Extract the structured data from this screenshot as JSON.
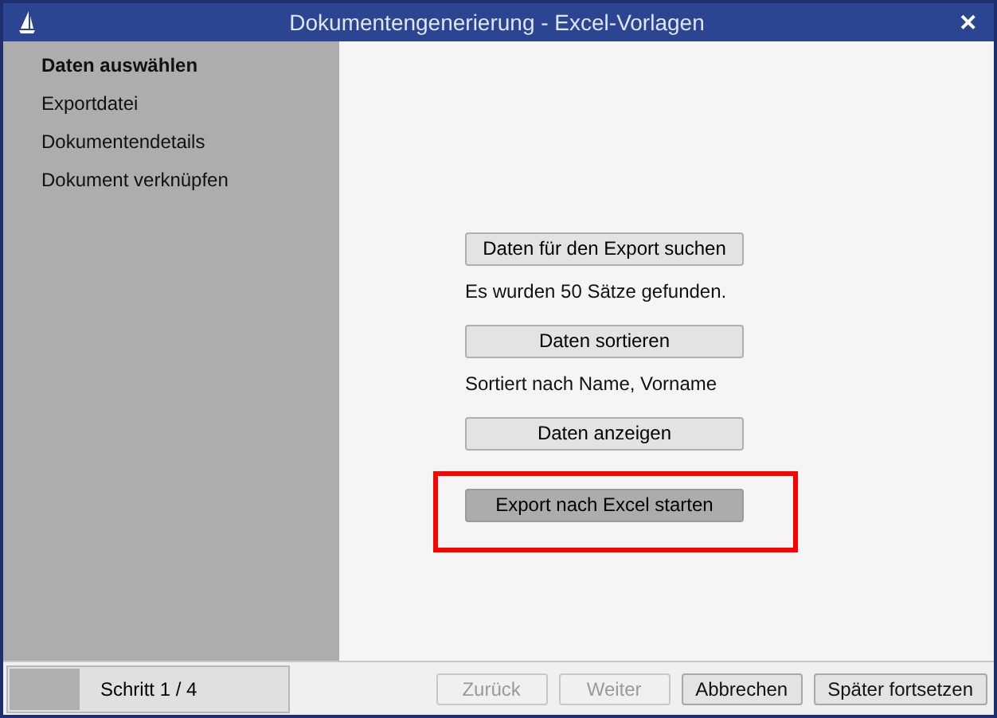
{
  "window": {
    "title": "Dokumentengenerierung - Excel-Vorlagen",
    "close": "✕"
  },
  "sidebar": {
    "items": [
      {
        "label": "Daten auswählen",
        "selected": true
      },
      {
        "label": "Exportdatei",
        "selected": false
      },
      {
        "label": "Dokumentendetails",
        "selected": false
      },
      {
        "label": "Dokument verknüpfen",
        "selected": false
      }
    ]
  },
  "actions": [
    {
      "kind": "button",
      "label": "Daten für den Export suchen",
      "highlighted": false
    },
    {
      "kind": "text",
      "label": "Es wurden 50 Sätze gefunden."
    },
    {
      "kind": "button",
      "label": "Daten sortieren",
      "highlighted": false
    },
    {
      "kind": "text",
      "label": "Sortiert nach Name, Vorname"
    },
    {
      "kind": "button",
      "label": "Daten anzeigen",
      "highlighted": false
    },
    {
      "kind": "button",
      "label": "Export nach Excel starten",
      "highlighted": true
    }
  ],
  "progress": {
    "level": 0.25,
    "label": "Schritt 1 / 4"
  },
  "footer_buttons": [
    {
      "label": "Zurück",
      "disabled": true
    },
    {
      "label": "Weiter",
      "disabled": true
    },
    {
      "label": "Abbrechen",
      "disabled": false
    },
    {
      "label": "Später fortsetzen",
      "disabled": false
    }
  ]
}
